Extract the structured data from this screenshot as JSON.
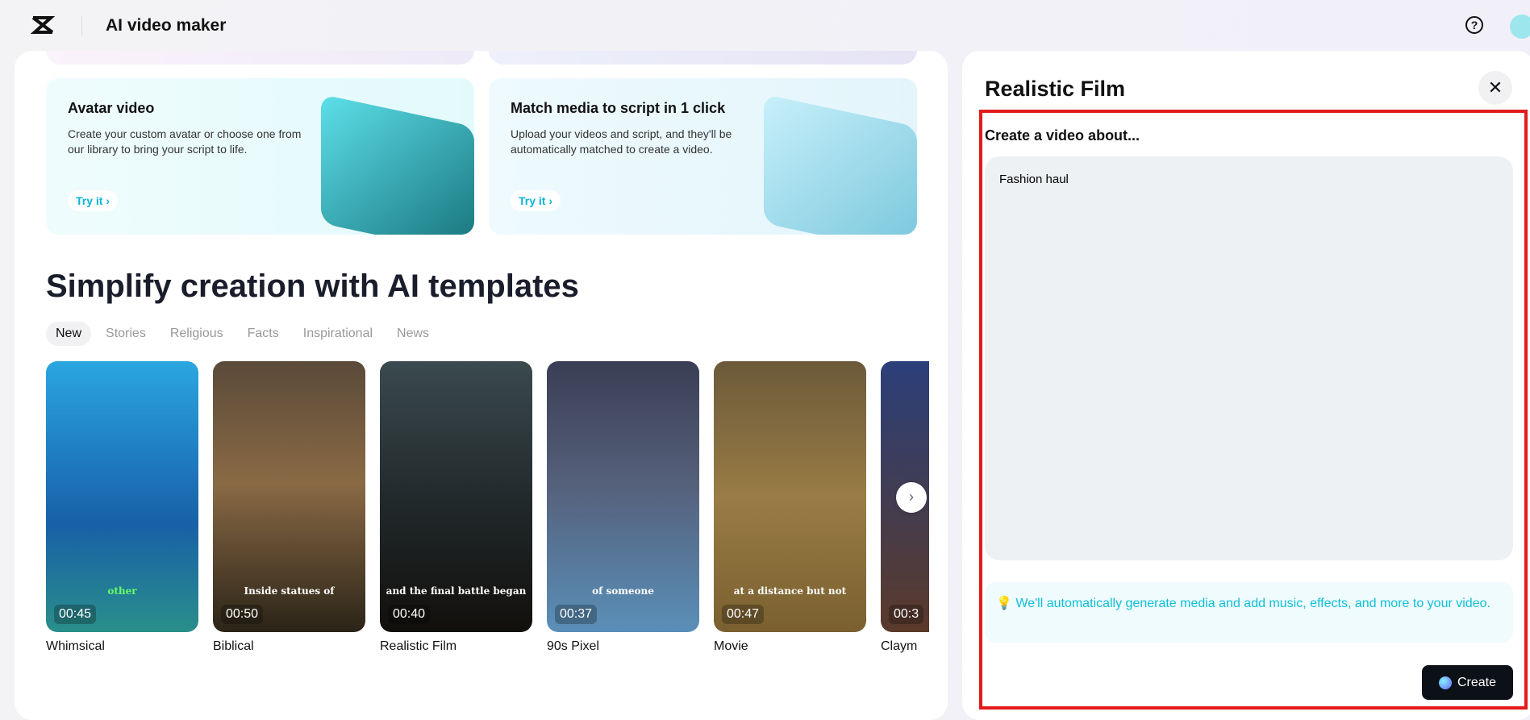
{
  "header": {
    "title": "AI video maker",
    "help_icon": "?"
  },
  "feature_cards": [
    {
      "title": "Avatar video",
      "desc": "Create your custom avatar or choose one from our library to bring your script to life.",
      "cta": "Try it ›"
    },
    {
      "title": "Match media to script in 1 click",
      "desc": "Upload your videos and script, and they'll be automatically matched to create a video.",
      "cta": "Try it ›"
    }
  ],
  "templates": {
    "heading": "Simplify creation with AI templates",
    "tabs": [
      "New",
      "Stories",
      "Religious",
      "Facts",
      "Inspirational",
      "News"
    ],
    "items": [
      {
        "label": "Whimsical",
        "duration": "00:45",
        "caption": "other"
      },
      {
        "label": "Biblical",
        "duration": "00:50",
        "caption": "Inside statues of"
      },
      {
        "label": "Realistic Film",
        "duration": "00:40",
        "caption": "and the final battle began"
      },
      {
        "label": "90s Pixel",
        "duration": "00:37",
        "caption": "of someone"
      },
      {
        "label": "Movie",
        "duration": "00:47",
        "caption": "at a distance but not"
      },
      {
        "label": "Claym",
        "duration": "00:3"
      }
    ]
  },
  "panel": {
    "title": "Realistic Film",
    "prompt_label": "Create a video about...",
    "prompt_value": "Fashion haul",
    "info": "We'll automatically generate media and add music, effects, and more to your video.",
    "create_label": "Create"
  }
}
